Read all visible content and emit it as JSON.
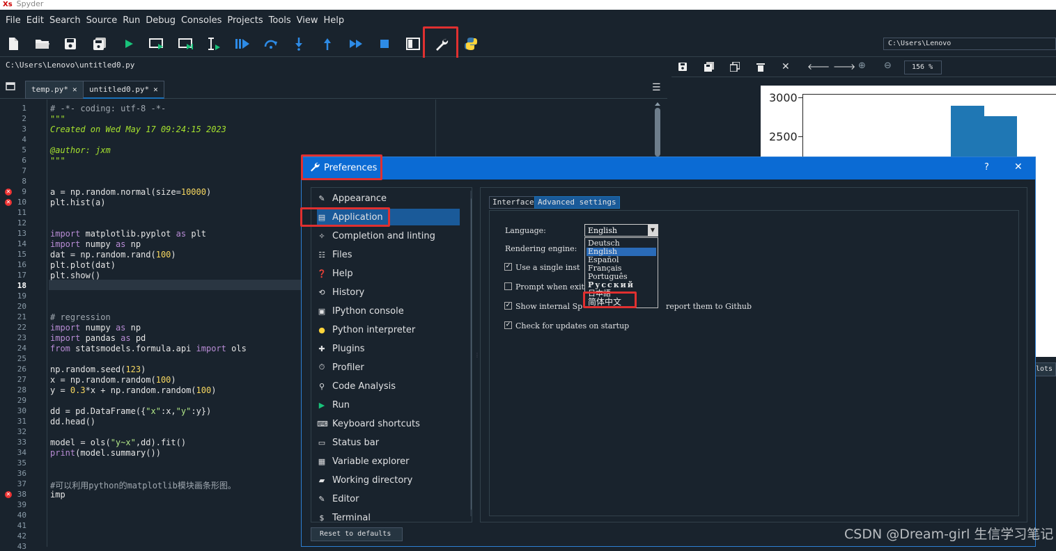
{
  "window": {
    "app_name": "Spyder",
    "logo": "Xs"
  },
  "menu": [
    "File",
    "Edit",
    "Search",
    "Source",
    "Run",
    "Debug",
    "Consoles",
    "Projects",
    "Tools",
    "View",
    "Help"
  ],
  "toolbar": {
    "icons": [
      "new-file-icon",
      "open-file-icon",
      "save-icon",
      "save-all-icon",
      "run-icon",
      "run-cell-icon",
      "run-cell-advance-icon",
      "run-selection-icon",
      "debug-icon",
      "step-over-icon",
      "step-into-icon",
      "step-out-icon",
      "continue-icon",
      "stop-icon",
      "maximize-pane-icon",
      "preferences-wrench-icon",
      "python-path-icon"
    ],
    "path": "C:\\Users\\Lenovo"
  },
  "editor": {
    "file_path": "C:\\Users\\Lenovo\\untitled0.py",
    "tabs": [
      {
        "label": "temp.py*"
      },
      {
        "label": "untitled0.py*"
      }
    ],
    "current_line": 18,
    "error_lines": [
      9,
      10,
      38
    ],
    "line_numbers": [
      "1",
      "2",
      "3",
      "4",
      "5",
      "6",
      "7",
      "8",
      "9",
      "10",
      "11",
      "12",
      "13",
      "14",
      "15",
      "16",
      "17",
      "18",
      "19",
      "20",
      "21",
      "22",
      "23",
      "24",
      "25",
      "26",
      "27",
      "28",
      "29",
      "30",
      "31",
      "32",
      "33",
      "34",
      "35",
      "36",
      "37",
      "38",
      "39",
      "40",
      "41",
      "42",
      "43"
    ]
  },
  "plots": {
    "zoom": "156 %",
    "y_ticks": [
      "3000",
      "2500"
    ],
    "side_tab": "lots"
  },
  "preferences": {
    "title": "Preferences",
    "help": "?",
    "close": "✕",
    "items": [
      "Appearance",
      "Application",
      "Completion and linting",
      "Files",
      "Help",
      "History",
      "IPython console",
      "Python interpreter",
      "Plugins",
      "Profiler",
      "Code Analysis",
      "Run",
      "Keyboard shortcuts",
      "Status bar",
      "Variable explorer",
      "Working directory",
      "Editor",
      "Terminal"
    ],
    "selected": "Application",
    "reset_label": "Reset to defaults",
    "tabs": [
      "Interface",
      "Advanced settings"
    ],
    "language_label": "Language:",
    "language_value": "English",
    "rendering_label": "Rendering engine:",
    "checkboxes": [
      {
        "label": "Use a single inst",
        "checked": true
      },
      {
        "label": "Prompt when exiti",
        "checked": false
      },
      {
        "label": "Show internal Sp",
        "tail": "report them to Github",
        "checked": true
      },
      {
        "label": "Check for updates on startup",
        "checked": true
      }
    ],
    "language_options": [
      "Deutsch",
      "English",
      "Español",
      "Français",
      "Português",
      "Русский",
      "日本語",
      "简体中文"
    ],
    "language_highlight": "English"
  },
  "watermark": "CSDN @Dream-girl 生信学习笔记",
  "accent_colors": {
    "highlight": "#e03030",
    "header": "#0b6bd4",
    "selection": "#1a5a99"
  }
}
